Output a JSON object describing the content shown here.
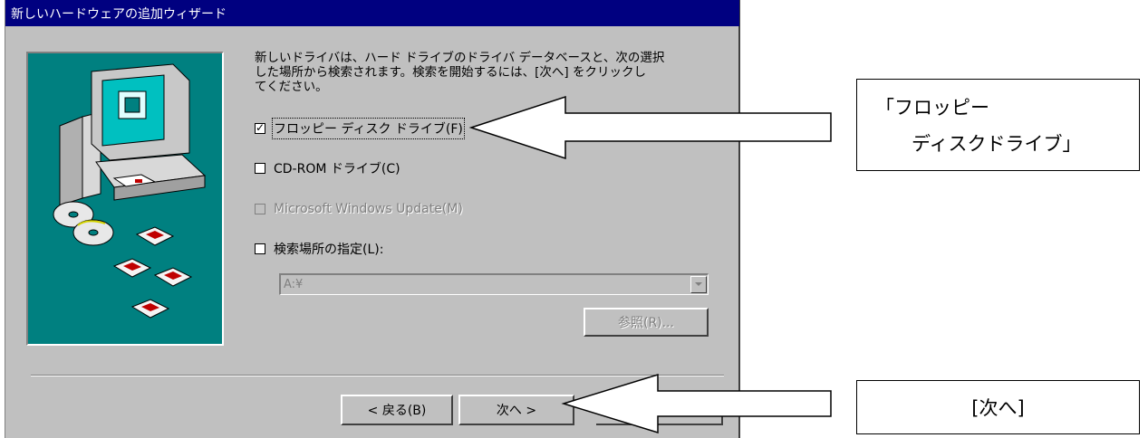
{
  "window": {
    "title": "新しいハードウェアの追加ウィザード"
  },
  "intro": {
    "lines": [
      "新しいドライバは、ハード ドライブのドライバ データベースと、次の選択",
      "した場所から検索されます。検索を開始するには、[次へ] をクリックし",
      "てください。"
    ]
  },
  "options": [
    {
      "label": "フロッピー ディスク ドライブ(F)",
      "checked": true,
      "enabled": true
    },
    {
      "label": "CD-ROM ドライブ(C)",
      "checked": false,
      "enabled": true
    },
    {
      "label": "Microsoft Windows Update(M)",
      "checked": false,
      "enabled": false
    },
    {
      "label": "検索場所の指定(L):",
      "checked": false,
      "enabled": true
    }
  ],
  "location_combo": {
    "value": "A:¥",
    "enabled": false
  },
  "browse_button": {
    "label": "参照(R)...",
    "enabled": false
  },
  "nav": {
    "back_label": "< 戻る(B)",
    "next_label": "次へ >"
  },
  "callouts": {
    "floppy_line1": "「フロッピー",
    "floppy_line2": "ディスクドライブ」",
    "next": "[次へ]"
  },
  "colors": {
    "titlebar": "#000080",
    "dialog": "#c0c0c0",
    "art_bg": "#008080",
    "monitor_screen": "#00c0c0"
  }
}
